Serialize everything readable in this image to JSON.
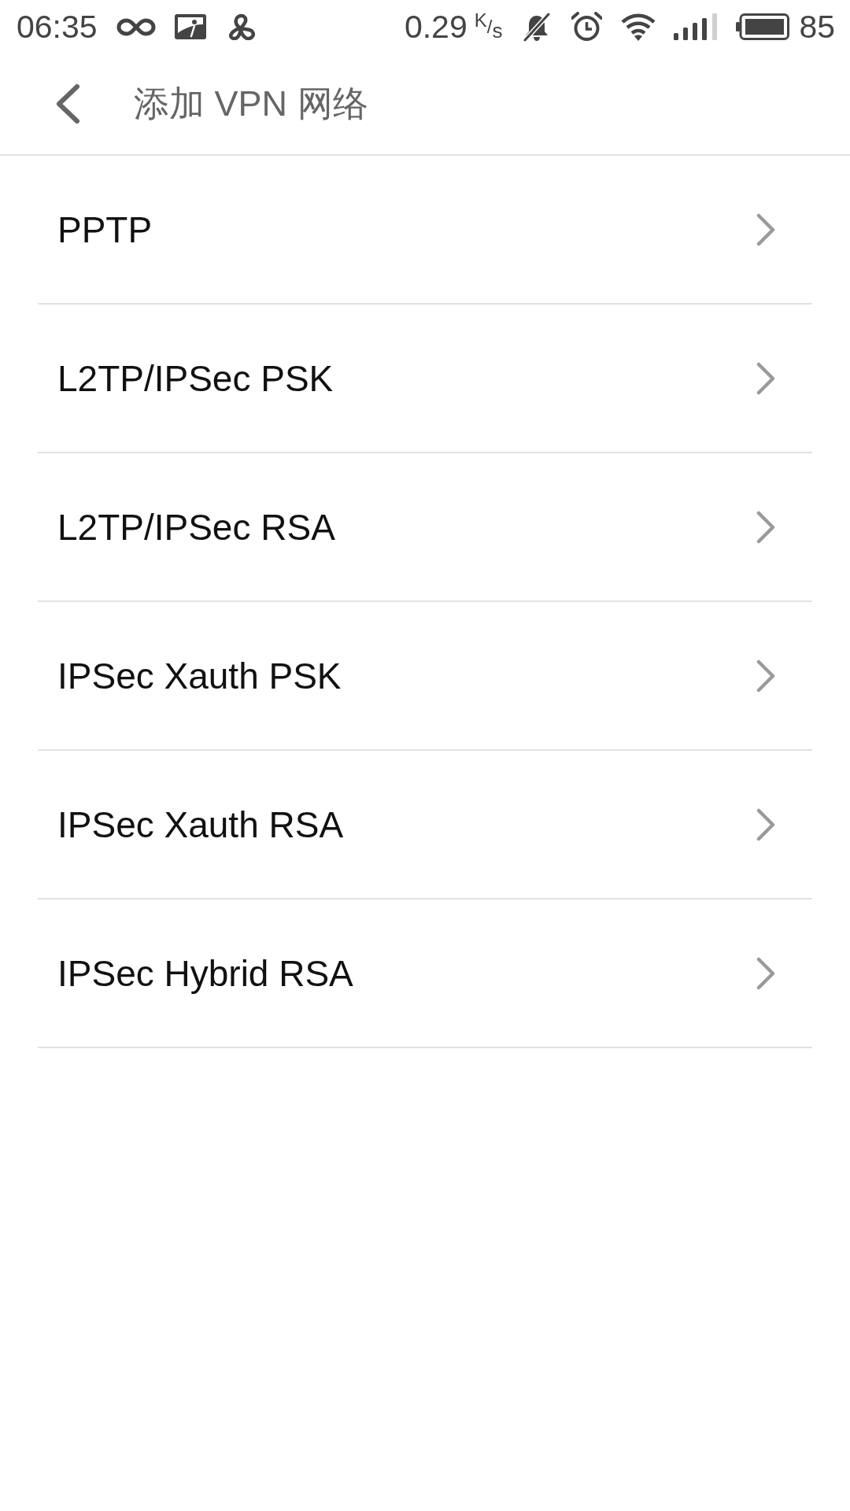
{
  "status_bar": {
    "time": "06:35",
    "net_speed": "0.29",
    "net_speed_unit": "$^{K}$/$_{s}$",
    "battery": "85"
  },
  "header": {
    "title": "添加 VPN 网络"
  },
  "vpn_types": [
    {
      "label": "PPTP"
    },
    {
      "label": "L2TP/IPSec PSK"
    },
    {
      "label": "L2TP/IPSec RSA"
    },
    {
      "label": "IPSec Xauth PSK"
    },
    {
      "label": "IPSec Xauth RSA"
    },
    {
      "label": "IPSec Hybrid RSA"
    }
  ]
}
